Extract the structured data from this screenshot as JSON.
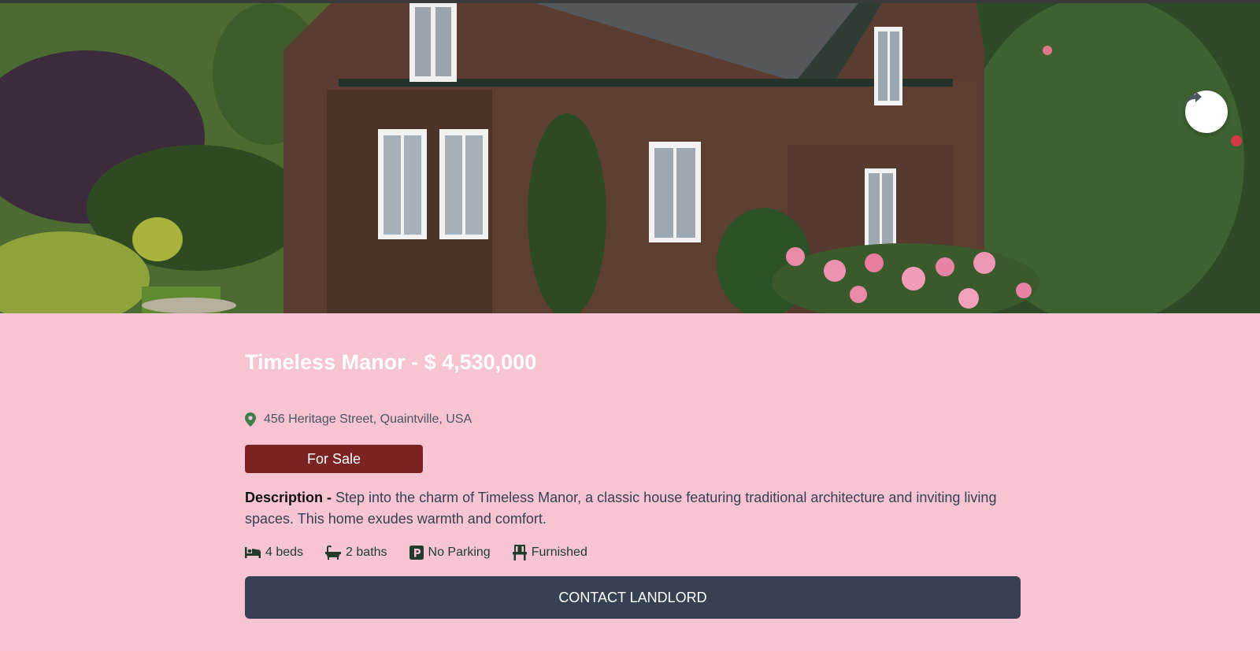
{
  "hero": {
    "image_icon": "house-photo",
    "share_icon": "share-icon"
  },
  "listing": {
    "title": "Timeless Manor - $ 4,530,000",
    "address": "456 Heritage Street, Quaintville, USA",
    "address_icon": "location-pin-icon",
    "status": "For Sale",
    "description_label": "Description -",
    "description_text": " Step into the charm of Timeless Manor, a classic house featuring traditional architecture and inviting living spaces. This home exudes warmth and comfort.",
    "features": [
      {
        "icon": "bed-icon",
        "label": "4 beds"
      },
      {
        "icon": "bath-icon",
        "label": "2 baths"
      },
      {
        "icon": "parking-icon",
        "label": "No Parking"
      },
      {
        "icon": "chair-icon",
        "label": "Furnished"
      }
    ],
    "contact_label": "CONTACT LANDLORD"
  },
  "colors": {
    "page_bg": "#f6c4d3",
    "status_badge": "#7c2424",
    "contact_button": "#374151",
    "feature_text": "#1f3d2a",
    "pin_icon": "#3f7d4f"
  }
}
